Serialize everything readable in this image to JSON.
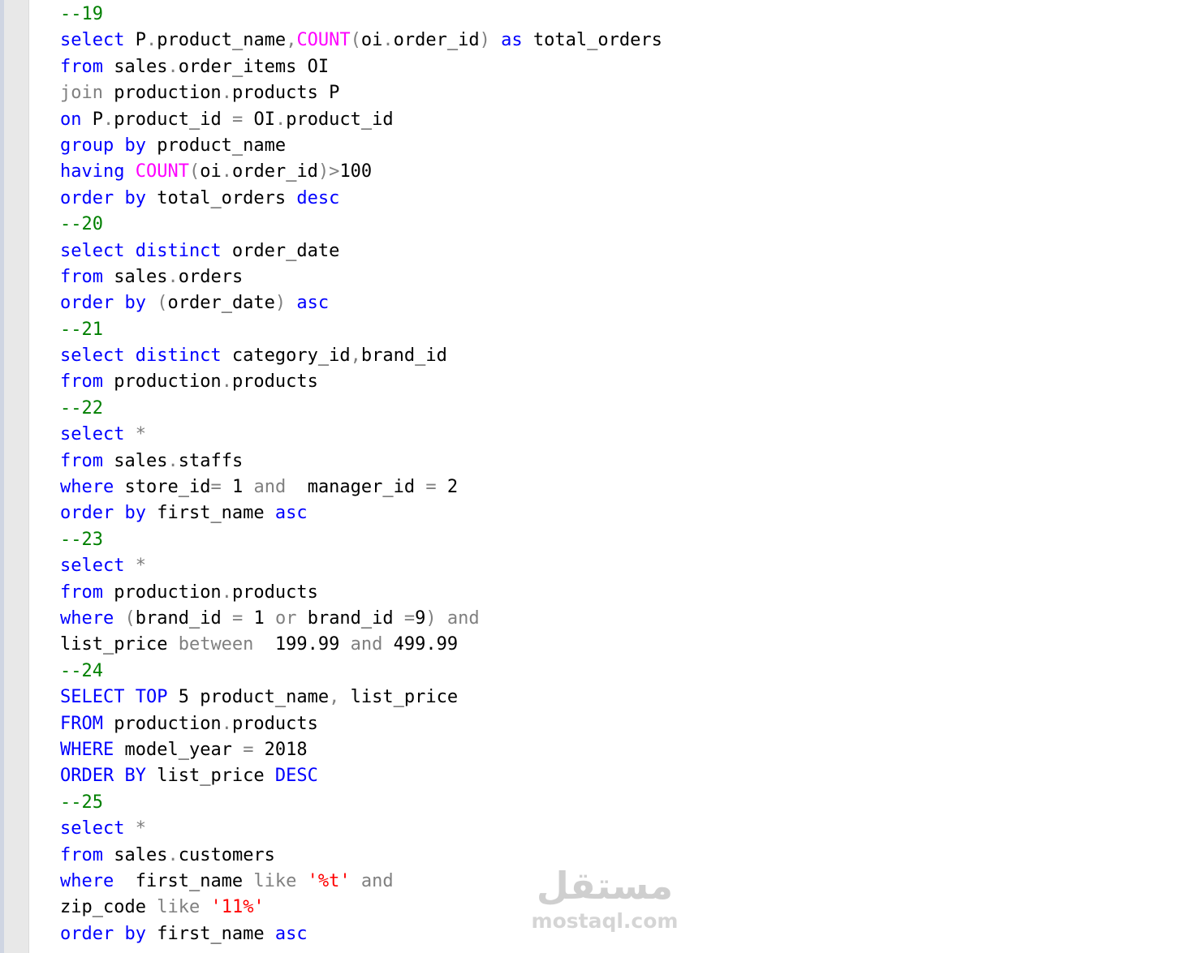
{
  "colors": {
    "keyword": "#0000ff",
    "function": "#ff00ff",
    "operator": "#808080",
    "comment": "#008000",
    "string": "#ff0000",
    "identifier": "#000000"
  },
  "editor": {
    "lines": [
      [
        {
          "t": "cm",
          "v": "--19"
        }
      ],
      [
        {
          "t": "kw",
          "v": "select"
        },
        {
          "t": "id",
          "v": " P"
        },
        {
          "t": "op",
          "v": "."
        },
        {
          "t": "id",
          "v": "product_name"
        },
        {
          "t": "op",
          "v": ","
        },
        {
          "t": "fn",
          "v": "COUNT"
        },
        {
          "t": "op",
          "v": "("
        },
        {
          "t": "id",
          "v": "oi"
        },
        {
          "t": "op",
          "v": "."
        },
        {
          "t": "id",
          "v": "order_id"
        },
        {
          "t": "op",
          "v": ")"
        },
        {
          "t": "id",
          "v": " "
        },
        {
          "t": "kw",
          "v": "as"
        },
        {
          "t": "id",
          "v": " total_orders"
        }
      ],
      [
        {
          "t": "kw",
          "v": "from"
        },
        {
          "t": "id",
          "v": " sales"
        },
        {
          "t": "op",
          "v": "."
        },
        {
          "t": "id",
          "v": "order_items OI"
        }
      ],
      [
        {
          "t": "op",
          "v": "join"
        },
        {
          "t": "id",
          "v": " production"
        },
        {
          "t": "op",
          "v": "."
        },
        {
          "t": "id",
          "v": "products P"
        }
      ],
      [
        {
          "t": "kw",
          "v": "on"
        },
        {
          "t": "id",
          "v": " P"
        },
        {
          "t": "op",
          "v": "."
        },
        {
          "t": "id",
          "v": "product_id "
        },
        {
          "t": "op",
          "v": "="
        },
        {
          "t": "id",
          "v": " OI"
        },
        {
          "t": "op",
          "v": "."
        },
        {
          "t": "id",
          "v": "product_id"
        }
      ],
      [
        {
          "t": "kw",
          "v": "group by"
        },
        {
          "t": "id",
          "v": " product_name"
        }
      ],
      [
        {
          "t": "kw",
          "v": "having"
        },
        {
          "t": "id",
          "v": " "
        },
        {
          "t": "fn",
          "v": "COUNT"
        },
        {
          "t": "op",
          "v": "("
        },
        {
          "t": "id",
          "v": "oi"
        },
        {
          "t": "op",
          "v": "."
        },
        {
          "t": "id",
          "v": "order_id"
        },
        {
          "t": "op",
          "v": ")>"
        },
        {
          "t": "id",
          "v": "100"
        }
      ],
      [
        {
          "t": "kw",
          "v": "order by"
        },
        {
          "t": "id",
          "v": " total_orders "
        },
        {
          "t": "kw",
          "v": "desc"
        }
      ],
      [
        {
          "t": "cm",
          "v": "--20"
        }
      ],
      [
        {
          "t": "kw",
          "v": "select distinct"
        },
        {
          "t": "id",
          "v": " order_date"
        }
      ],
      [
        {
          "t": "kw",
          "v": "from"
        },
        {
          "t": "id",
          "v": " sales"
        },
        {
          "t": "op",
          "v": "."
        },
        {
          "t": "id",
          "v": "orders"
        }
      ],
      [
        {
          "t": "kw",
          "v": "order by"
        },
        {
          "t": "id",
          "v": " "
        },
        {
          "t": "op",
          "v": "("
        },
        {
          "t": "id",
          "v": "order_date"
        },
        {
          "t": "op",
          "v": ")"
        },
        {
          "t": "id",
          "v": " "
        },
        {
          "t": "kw",
          "v": "asc"
        }
      ],
      [
        {
          "t": "cm",
          "v": "--21"
        }
      ],
      [
        {
          "t": "kw",
          "v": "select distinct"
        },
        {
          "t": "id",
          "v": " category_id"
        },
        {
          "t": "op",
          "v": ","
        },
        {
          "t": "id",
          "v": "brand_id"
        }
      ],
      [
        {
          "t": "kw",
          "v": "from"
        },
        {
          "t": "id",
          "v": " production"
        },
        {
          "t": "op",
          "v": "."
        },
        {
          "t": "id",
          "v": "products"
        }
      ],
      [
        {
          "t": "cm",
          "v": "--22"
        }
      ],
      [
        {
          "t": "kw",
          "v": "select"
        },
        {
          "t": "id",
          "v": " "
        },
        {
          "t": "op",
          "v": "*"
        }
      ],
      [
        {
          "t": "kw",
          "v": "from"
        },
        {
          "t": "id",
          "v": " sales"
        },
        {
          "t": "op",
          "v": "."
        },
        {
          "t": "id",
          "v": "staffs"
        }
      ],
      [
        {
          "t": "kw",
          "v": "where"
        },
        {
          "t": "id",
          "v": " store_id"
        },
        {
          "t": "op",
          "v": "="
        },
        {
          "t": "id",
          "v": " 1 "
        },
        {
          "t": "op",
          "v": "and"
        },
        {
          "t": "id",
          "v": "  manager_id "
        },
        {
          "t": "op",
          "v": "="
        },
        {
          "t": "id",
          "v": " 2"
        }
      ],
      [
        {
          "t": "kw",
          "v": "order by"
        },
        {
          "t": "id",
          "v": " first_name "
        },
        {
          "t": "kw",
          "v": "asc"
        }
      ],
      [
        {
          "t": "cm",
          "v": "--23"
        }
      ],
      [
        {
          "t": "kw",
          "v": "select"
        },
        {
          "t": "id",
          "v": " "
        },
        {
          "t": "op",
          "v": "*"
        }
      ],
      [
        {
          "t": "kw",
          "v": "from"
        },
        {
          "t": "id",
          "v": " production"
        },
        {
          "t": "op",
          "v": "."
        },
        {
          "t": "id",
          "v": "products"
        }
      ],
      [
        {
          "t": "kw",
          "v": "where"
        },
        {
          "t": "id",
          "v": " "
        },
        {
          "t": "op",
          "v": "("
        },
        {
          "t": "id",
          "v": "brand_id "
        },
        {
          "t": "op",
          "v": "="
        },
        {
          "t": "id",
          "v": " 1 "
        },
        {
          "t": "op",
          "v": "or"
        },
        {
          "t": "id",
          "v": " brand_id "
        },
        {
          "t": "op",
          "v": "="
        },
        {
          "t": "id",
          "v": "9"
        },
        {
          "t": "op",
          "v": ")"
        },
        {
          "t": "id",
          "v": " "
        },
        {
          "t": "op",
          "v": "and"
        }
      ],
      [
        {
          "t": "id",
          "v": "list_price "
        },
        {
          "t": "op",
          "v": "between"
        },
        {
          "t": "id",
          "v": "  199.99 "
        },
        {
          "t": "op",
          "v": "and"
        },
        {
          "t": "id",
          "v": " 499.99"
        }
      ],
      [
        {
          "t": "cm",
          "v": "--24"
        }
      ],
      [
        {
          "t": "kw",
          "v": "SELECT TOP"
        },
        {
          "t": "id",
          "v": " 5 product_name"
        },
        {
          "t": "op",
          "v": ","
        },
        {
          "t": "id",
          "v": " list_price"
        }
      ],
      [
        {
          "t": "kw",
          "v": "FROM"
        },
        {
          "t": "id",
          "v": " production"
        },
        {
          "t": "op",
          "v": "."
        },
        {
          "t": "id",
          "v": "products"
        }
      ],
      [
        {
          "t": "kw",
          "v": "WHERE"
        },
        {
          "t": "id",
          "v": " model_year "
        },
        {
          "t": "op",
          "v": "="
        },
        {
          "t": "id",
          "v": " 2018"
        }
      ],
      [
        {
          "t": "kw",
          "v": "ORDER BY"
        },
        {
          "t": "id",
          "v": " list_price "
        },
        {
          "t": "kw",
          "v": "DESC"
        }
      ],
      [
        {
          "t": "cm",
          "v": "--25"
        }
      ],
      [
        {
          "t": "kw",
          "v": "select"
        },
        {
          "t": "id",
          "v": " "
        },
        {
          "t": "op",
          "v": "*"
        }
      ],
      [
        {
          "t": "kw",
          "v": "from"
        },
        {
          "t": "id",
          "v": " sales"
        },
        {
          "t": "op",
          "v": "."
        },
        {
          "t": "id",
          "v": "customers"
        }
      ],
      [
        {
          "t": "kw",
          "v": "where"
        },
        {
          "t": "id",
          "v": "  first_name "
        },
        {
          "t": "op",
          "v": "like"
        },
        {
          "t": "id",
          "v": " "
        },
        {
          "t": "str",
          "v": "'%t'"
        },
        {
          "t": "id",
          "v": " "
        },
        {
          "t": "op",
          "v": "and"
        }
      ],
      [
        {
          "t": "id",
          "v": "zip_code "
        },
        {
          "t": "op",
          "v": "like"
        },
        {
          "t": "id",
          "v": " "
        },
        {
          "t": "str",
          "v": "'11%'"
        }
      ],
      [
        {
          "t": "kw",
          "v": "order by"
        },
        {
          "t": "id",
          "v": " first_name "
        },
        {
          "t": "kw",
          "v": "asc"
        }
      ]
    ]
  },
  "watermark": {
    "brand": "مستقل",
    "domain": "mostaql.com"
  }
}
